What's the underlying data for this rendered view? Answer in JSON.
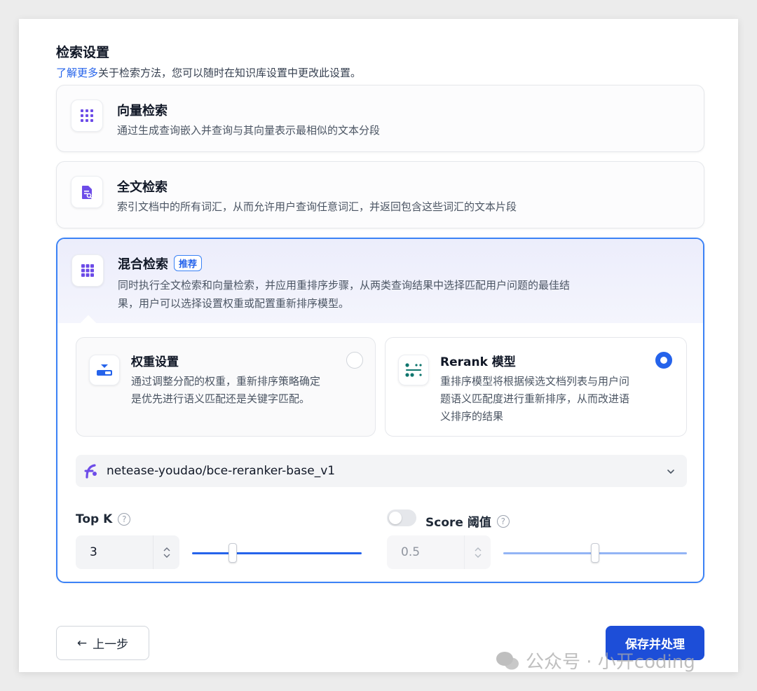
{
  "header": {
    "title": "检索设置",
    "learn_more": "了解更多",
    "subtitle": "关于检索方法，您可以随时在知识库设置中更改此设置。"
  },
  "methods": [
    {
      "title": "向量检索",
      "desc": "通过生成查询嵌入并查询与其向量表示最相似的文本分段",
      "icon": "grid-icon"
    },
    {
      "title": "全文检索",
      "desc": "索引文档中的所有词汇，从而允许用户查询任意词汇，并返回包含这些词汇的文本片段",
      "icon": "document-search-icon"
    },
    {
      "title": "混合检索",
      "badge": "推荐",
      "desc_line1": "同时执行全文检索和向量检索，并应用重排序步骤，从两类查询结果中选择匹配用户问题的最佳结",
      "desc_line2": "果，用户可以选择设置权重或配置重新排序模型。",
      "icon": "grid-icon",
      "selected": true
    }
  ],
  "hybrid": {
    "weight": {
      "title": "权重设置",
      "desc_line1": "通过调整分配的权重，重新排序策略确定",
      "desc_line2": "是优先进行语义匹配还是关键字匹配。",
      "selected": false
    },
    "rerank": {
      "title": "Rerank 模型",
      "desc_line1": "重排序模型将根据候选文档列表与用户问",
      "desc_line2": "题语义匹配度进行重新排序，从而改进语",
      "desc_line3": "义排序的结果",
      "selected": true
    },
    "model": "netease-youdao/bce-reranker-base_v1",
    "top_k": {
      "label": "Top K",
      "help": "?",
      "value": "3",
      "slider_fraction": 0.24
    },
    "score": {
      "label": "Score 阈值",
      "help": "?",
      "value": "0.5",
      "enabled": false,
      "slider_fraction": 0.5
    }
  },
  "footer": {
    "back_label": "上一步",
    "back_arrow": "←",
    "save_label": "保存并处理"
  },
  "watermark": "公众号 · 小开coding",
  "colors": {
    "accent": "#2563eb",
    "icon_purple": "#6d4ce8",
    "icon_green": "#0f766e"
  }
}
